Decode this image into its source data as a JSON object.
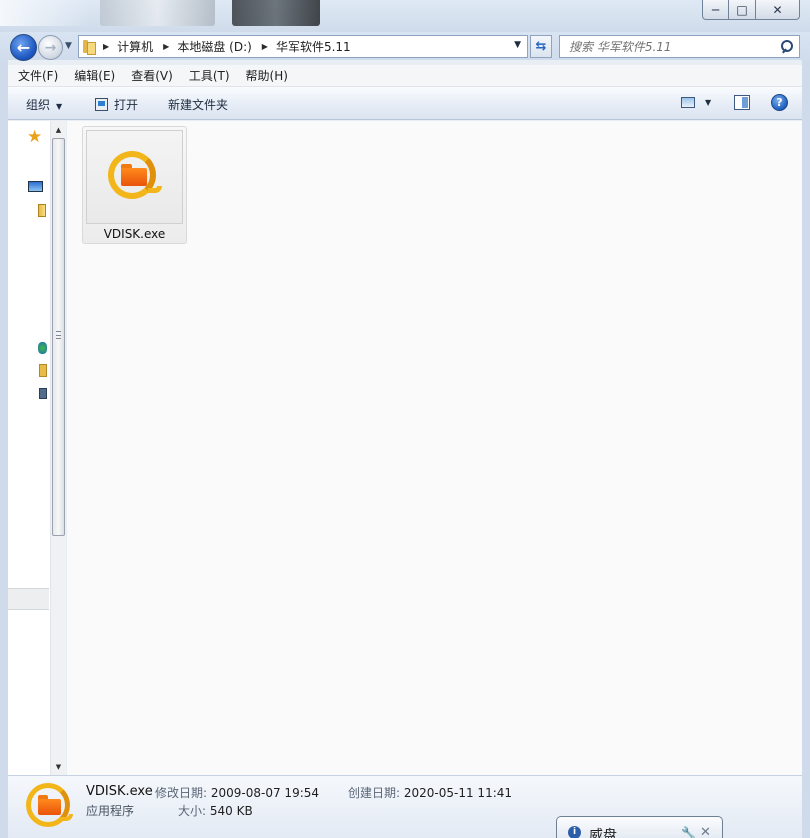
{
  "window": {
    "caption_minimize": "─",
    "caption_maximize": "□",
    "caption_close": "✕"
  },
  "address": {
    "crumbs": [
      "计算机",
      "本地磁盘 (D:)",
      "华军软件5.11"
    ],
    "search_placeholder": "搜索 华军软件5.11"
  },
  "menu": [
    "文件(F)",
    "编辑(E)",
    "查看(V)",
    "工具(T)",
    "帮助(H)"
  ],
  "commands": {
    "organize": "组织",
    "open": "打开",
    "new_folder": "新建文件夹",
    "help": "?"
  },
  "files": [
    {
      "name": "VDISK.exe",
      "icon": "vdisk-app-icon"
    }
  ],
  "details": {
    "name": "VDISK.exe",
    "type": "应用程序",
    "modified_label": "修改日期:",
    "modified_value": "2009-08-07 19:54",
    "size_label": "大小:",
    "size_value": "540 KB",
    "created_label": "创建日期:",
    "created_value": "2020-05-11 11:41"
  },
  "notification": {
    "title": "威盘"
  },
  "icons": {
    "back": "back-arrow-icon",
    "forward": "forward-arrow-icon",
    "search": "search-icon",
    "refresh": "refresh-icon",
    "favorites": "star-icon",
    "help": "help-icon"
  },
  "colors": {
    "accent": "#1d58c2",
    "vdisk_ring": "#f2b51a",
    "vdisk_folder": "#e9530a"
  }
}
